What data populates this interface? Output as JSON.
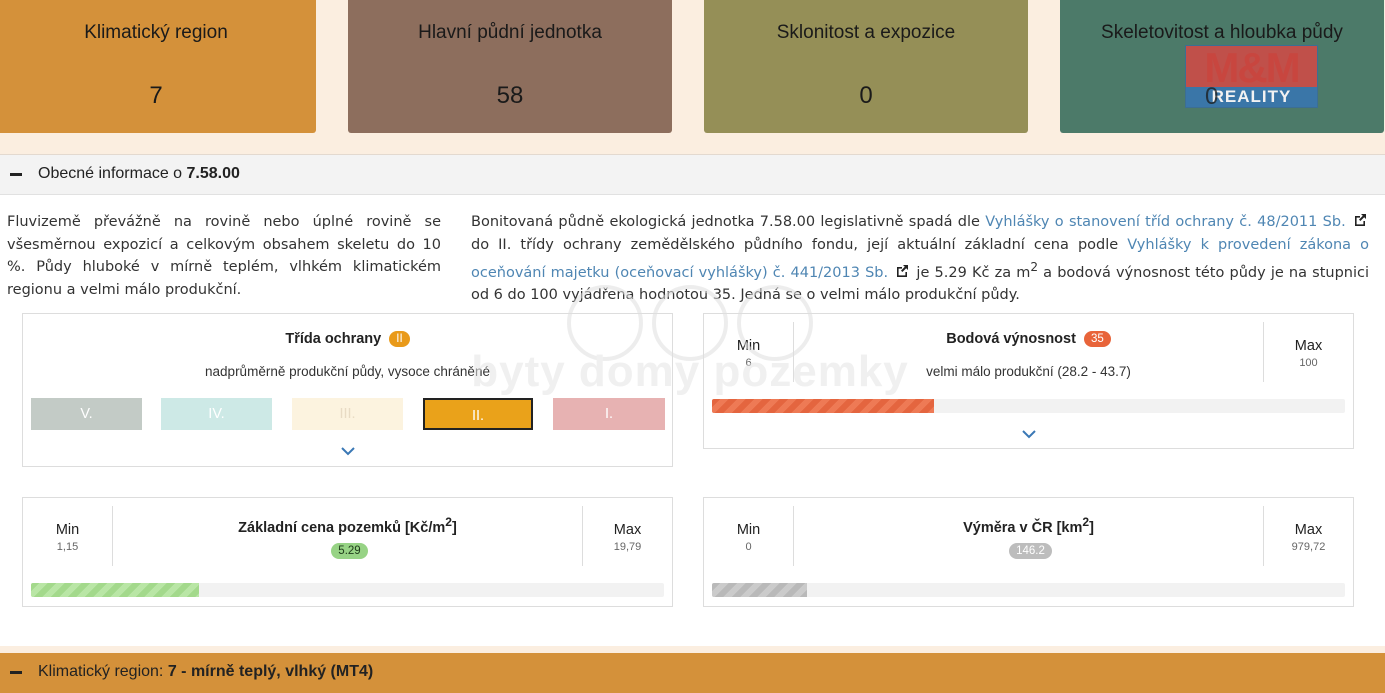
{
  "tiles": [
    {
      "title": "Klimatický region",
      "value": "7",
      "color": "#d4913a"
    },
    {
      "title": "Hlavní půdní jednotka",
      "value": "58",
      "color": "#8d6e5d"
    },
    {
      "title": "Sklonitost a expozice",
      "value": "0",
      "color": "#958f57"
    },
    {
      "title": "Skeletovitost a hloubka půdy",
      "value": "0",
      "color": "#4c7a69"
    }
  ],
  "watermark_logo": {
    "top": "M&M",
    "bottom": "REALITY"
  },
  "watermark_center": "byty domy pozemky",
  "general": {
    "header_prefix": "Obecné informace o ",
    "header_code": "7.58.00",
    "left_text": "Fluvizemě převážně na rovině nebo úplné rovině se všesměrnou expozicí a celkovým obsahem skeletu do 10 %. Půdy hluboké v mírně teplém, vlhkém klimatickém regionu a velmi málo produkční.",
    "right_1": "Bonitovaná půdně ekologická jednotka 7.58.00 legislativně spadá dle ",
    "right_link_1": "Vyhlášky o stanovení tříd ochrany č. 48/2011 Sb.",
    "right_2": " do II. třídy ochrany zemědělského půdního fondu, její aktuální základní cena podle ",
    "right_link_2": "Vyhlášky k provedení zákona o oceňování majetku (oceňovací vyhlášky) č. 441/2013 Sb.",
    "right_3": " je 5.29 Kč za m",
    "right_sup": "2",
    "right_4": " a bodová výnosnost této půdy je na stupnici od 6 do 100 vyjádřena hodnotou 35. Jedná se o velmi málo produkční půdy."
  },
  "protection": {
    "title": "Třída ochrany",
    "badge": "II",
    "subtitle": "nadprůměrně produkční půdy, vysoce chráněné",
    "classes": [
      "V.",
      "IV.",
      "III.",
      "II.",
      "I."
    ],
    "selected": "II."
  },
  "yield": {
    "title": "Bodová výnosnost",
    "badge": "35",
    "subtitle": "velmi málo produkční (28.2 - 43.7)",
    "min_label": "Min",
    "min": "6",
    "max_label": "Max",
    "max": "100",
    "fill": 0.35
  },
  "price": {
    "title": "Základní cena pozemků [Kč/m",
    "title_sup": "2",
    "title_end": "]",
    "badge": "5.29",
    "min_label": "Min",
    "min": "1,15",
    "max_label": "Max",
    "max": "19,79",
    "fill": 0.265
  },
  "area": {
    "title": "Výměra v ČR [km",
    "title_sup": "2",
    "title_end": "]",
    "badge": "146.2",
    "min_label": "Min",
    "min": "0",
    "max_label": "Max",
    "max": "979,72",
    "fill": 0.15
  },
  "climate": {
    "header_prefix": "Klimatický region: ",
    "header_value": "7 - mírně teplý, vlhký (MT4)"
  }
}
